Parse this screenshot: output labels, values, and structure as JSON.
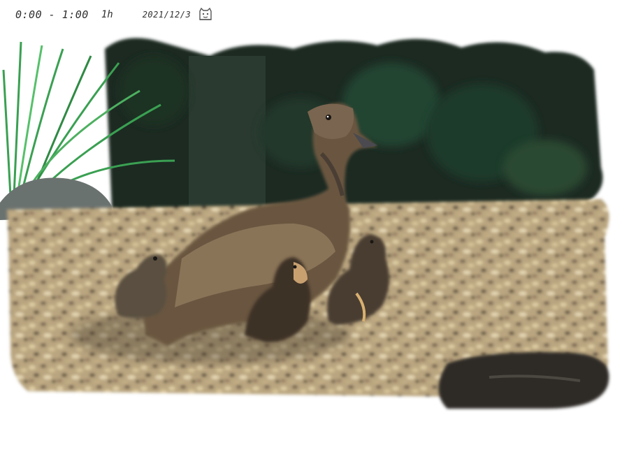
{
  "header": {
    "time_range": "0:00 - 1:00",
    "duration": "1h",
    "date": "2021/12/3"
  },
  "stamp_icon": "cat-face-stamp-icon",
  "colors": {
    "foliage_dark": "#1c2a22",
    "foliage_mid": "#2d4a35",
    "grass_green": "#3aa052",
    "gravel_light": "#c9b48c",
    "gravel_dark": "#5a4a3a",
    "duck_brown": "#6b5640",
    "shadow": "#2a2824"
  }
}
